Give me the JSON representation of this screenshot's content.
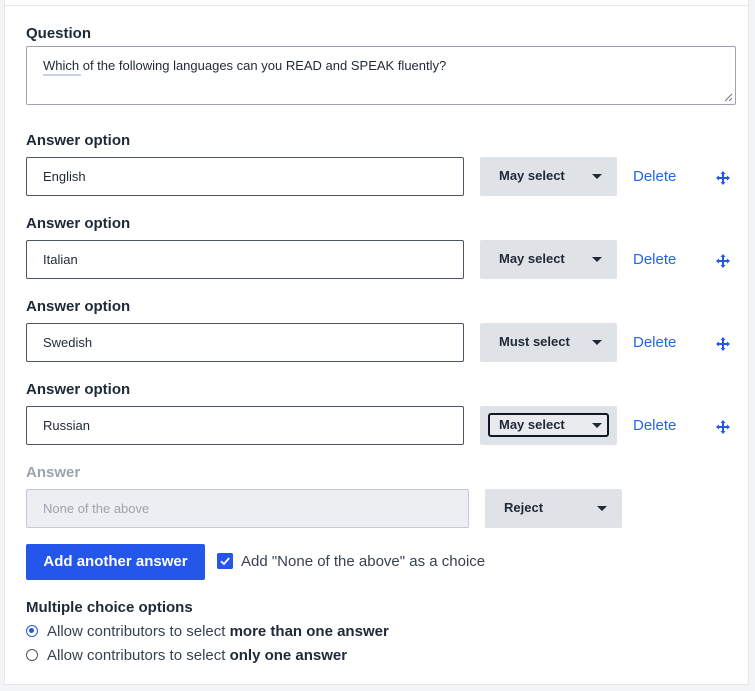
{
  "question": {
    "label": "Question",
    "value": "Which of the following languages can you READ and SPEAK fluently?"
  },
  "answer_options": [
    {
      "label": "Answer option",
      "value": "English",
      "select": "May select",
      "delete": "Delete"
    },
    {
      "label": "Answer option",
      "value": "Italian",
      "select": "May select",
      "delete": "Delete"
    },
    {
      "label": "Answer option",
      "value": "Swedish",
      "select": "Must select",
      "delete": "Delete"
    },
    {
      "label": "Answer option",
      "value": "Russian",
      "select": "May select",
      "delete": "Delete"
    }
  ],
  "none_answer": {
    "label": "Answer",
    "placeholder": "None of the above",
    "select": "Reject"
  },
  "actions": {
    "add_button": "Add another answer",
    "none_checkbox_label": "Add \"None of the above\" as a choice",
    "none_checkbox_checked": true
  },
  "multiple_choice": {
    "title": "Multiple choice options",
    "options": [
      {
        "prefix": "Allow contributors to select ",
        "bold": "more than one answer",
        "checked": true
      },
      {
        "prefix": "Allow contributors to select ",
        "bold": "only one answer",
        "checked": false
      }
    ]
  },
  "colors": {
    "accent": "#2456e9",
    "link": "#2563eb",
    "select_bg": "#dfe2e7"
  },
  "icons": {
    "move": "move-arrows-icon",
    "check": "checkmark-icon",
    "caret": "caret-down-icon"
  }
}
